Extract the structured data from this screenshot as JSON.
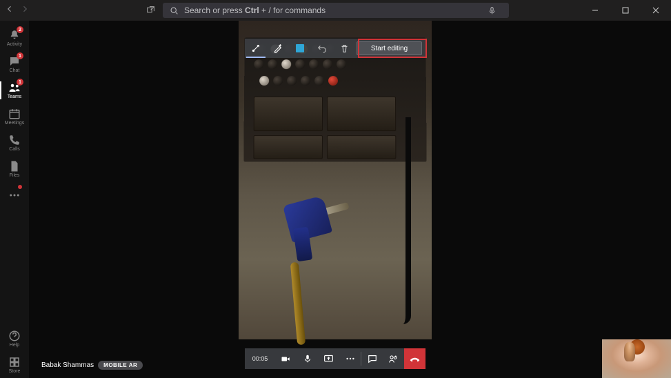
{
  "search": {
    "placeholder_prefix": "Search or press ",
    "placeholder_key": "Ctrl",
    "placeholder_suffix": " + / for commands"
  },
  "rail": {
    "items": [
      {
        "label": "Activity",
        "badge": "2"
      },
      {
        "label": "Chat",
        "badge": "1"
      },
      {
        "label": "Teams",
        "badge": "1"
      },
      {
        "label": "Meetings"
      },
      {
        "label": "Calls"
      },
      {
        "label": "Files"
      }
    ],
    "help": "Help",
    "store": "Store"
  },
  "annot": {
    "tools": [
      "laser-pointer-tool",
      "pen-tool",
      "shape-tool",
      "undo-tool",
      "delete-tool"
    ],
    "start_label": "Start editing"
  },
  "call": {
    "duration": "00:05"
  },
  "caller": {
    "name": "Babak Shammas",
    "tag": "MOBILE AR"
  }
}
